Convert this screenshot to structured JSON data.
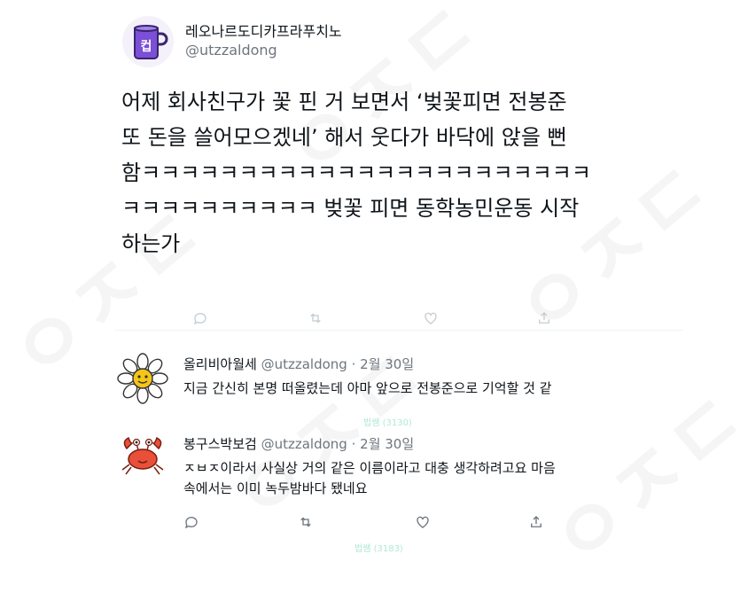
{
  "tweet": {
    "author_name": "레오나르도디카프라푸치노",
    "author_handle": "@utzzaldong",
    "avatar_letter": "컵",
    "lines": [
      "어제 회사친구가 꽃 핀 거 보면서 ‘벚꽃피면 전봉준",
      "또 돈을 쓸어모으겠네’ 해서 웃다가 바닥에 앉을 뻔",
      "함ㅋㅋㅋㅋㅋㅋㅋㅋㅋㅋㅋㅋㅋㅋㅋㅋㅋㅋㅋㅋㅋㅋㅋ",
      "ㅋㅋㅋㅋㅋㅋㅋㅋㅋㅋ 벚꽃 피면 동학농민운동 시작",
      "하는가"
    ]
  },
  "replies": [
    {
      "name": "올리비아월세",
      "handle": "@utzzaldong",
      "date": "2월 30일",
      "text": [
        "지금 간신히 본명 떠올렸는데 아마 앞으로 전봉준으로 기억할 것 같"
      ],
      "avatar": "daisy-avatar"
    },
    {
      "name": "봉구스박보검",
      "handle": "@utzzaldong",
      "date": "2월 30일",
      "text": [
        "ㅈㅂㅈ이라서 사실상 거의 같은 이름이라고 대충 생각하려고요 마음",
        "속에서는 이미 녹두밤바다 됐네요"
      ],
      "avatar": "crab-avatar"
    }
  ],
  "faint_labels": [
    "법쌤 (3130)",
    "법쌤 (3183)"
  ],
  "colors": {
    "text": "#0f1419",
    "muted": "#6e767d",
    "cup": "#7b4fd6"
  }
}
